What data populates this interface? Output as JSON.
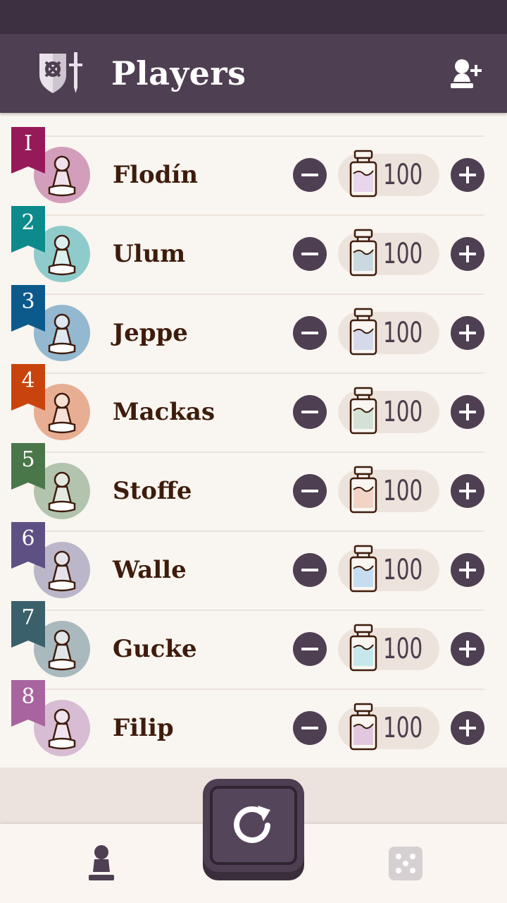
{
  "app_bar": {
    "title": "Players",
    "logo_icon": "shield-sword-icon",
    "add_icon": "add-player-icon"
  },
  "colors": {
    "status_bar": "#3d3040",
    "app_bar": "#4f3f52",
    "background": "#f9f5f0",
    "name_text": "#3e1c0c",
    "button": "#4f3f52",
    "pill": "#ede3dd"
  },
  "players": [
    {
      "rank": "I",
      "name": "Flodín",
      "health": "100",
      "ribbon_color": "#96195a",
      "avatar_color": "#d29ebb",
      "pawn_color": "#f1e1ea",
      "potion_color": "#e8d6ec"
    },
    {
      "rank": "2",
      "name": "Ulum",
      "health": "100",
      "ribbon_color": "#0c8a8c",
      "avatar_color": "#90cbcb",
      "pawn_color": "#dcf0f0",
      "potion_color": "#c9d9df"
    },
    {
      "rank": "3",
      "name": "Jeppe",
      "health": "100",
      "ribbon_color": "#0c5a8c",
      "avatar_color": "#93b8cf",
      "pawn_color": "#dde8f1",
      "potion_color": "#d6d9ea"
    },
    {
      "rank": "4",
      "name": "Mackas",
      "health": "100",
      "ribbon_color": "#c8440c",
      "avatar_color": "#e8ae94",
      "pawn_color": "#f7e0d6",
      "potion_color": "#d4e2d6"
    },
    {
      "rank": "5",
      "name": "Stoffe",
      "health": "100",
      "ribbon_color": "#4a774a",
      "avatar_color": "#b2c4ae",
      "pawn_color": "#e3ebe1",
      "potion_color": "#f1d4c6"
    },
    {
      "rank": "6",
      "name": "Walle",
      "health": "100",
      "ribbon_color": "#5f5084",
      "avatar_color": "#bcb6ca",
      "pawn_color": "#e6e3ed",
      "potion_color": "#c6ddf0"
    },
    {
      "rank": "7",
      "name": "Gucke",
      "health": "100",
      "ribbon_color": "#3a606c",
      "avatar_color": "#a9b9be",
      "pawn_color": "#e1e7e9",
      "potion_color": "#c6e8ec"
    },
    {
      "rank": "8",
      "name": "Filip",
      "health": "100",
      "ribbon_color": "#a8649e",
      "avatar_color": "#d8bcd4",
      "pawn_color": "#f0e4ee",
      "potion_color": "#e2c8de"
    }
  ],
  "bottom_nav": {
    "players_icon": "pawn-icon",
    "dice_icon": "dice-icon",
    "reset_icon": "reset-icon"
  }
}
